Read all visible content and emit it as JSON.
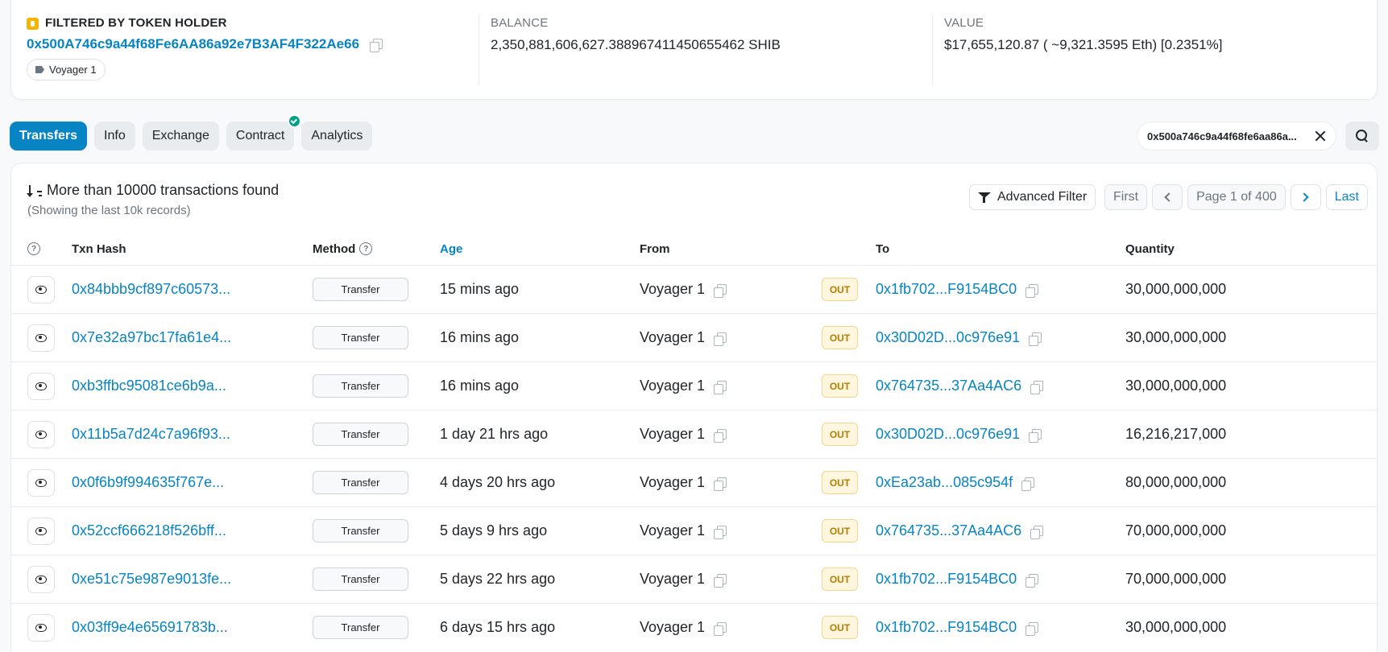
{
  "summary": {
    "holder_label": "FILTERED BY TOKEN HOLDER",
    "holder_address": "0x500A746c9a44f68Fe6AA86a92e7B3AF4F322Ae66",
    "holder_tag": "Voyager 1",
    "balance_label": "BALANCE",
    "balance_value": "2,350,881,606,627.388967411450655462 SHIB",
    "value_label": "VALUE",
    "value_value": "$17,655,120.87 ( ~9,321.3595 Eth) [0.2351%]"
  },
  "tabs": [
    {
      "label": "Transfers",
      "active": true
    },
    {
      "label": "Info"
    },
    {
      "label": "Exchange"
    },
    {
      "label": "Contract",
      "verified": true
    },
    {
      "label": "Analytics"
    }
  ],
  "filter_chip": "0x500a746c9a44f68fe6aa86a...",
  "results": {
    "count_text": "More than 10000 transactions found",
    "sub_text": "(Showing the last 10k records)",
    "advanced_filter": "Advanced Filter",
    "pager": {
      "first": "First",
      "page": "Page 1 of 400",
      "last": "Last"
    }
  },
  "table": {
    "headers": {
      "hash": "Txn Hash",
      "method": "Method",
      "age": "Age",
      "from": "From",
      "to": "To",
      "quantity": "Quantity"
    },
    "rows": [
      {
        "hash": "0x84bbb9cf897c60573...",
        "method": "Transfer",
        "age": "15 mins ago",
        "from": "Voyager 1",
        "dir": "OUT",
        "to": "0x1fb702...F9154BC0",
        "qty": "30,000,000,000"
      },
      {
        "hash": "0x7e32a97bc17fa61e4...",
        "method": "Transfer",
        "age": "16 mins ago",
        "from": "Voyager 1",
        "dir": "OUT",
        "to": "0x30D02D...0c976e91",
        "qty": "30,000,000,000"
      },
      {
        "hash": "0xb3ffbc95081ce6b9a...",
        "method": "Transfer",
        "age": "16 mins ago",
        "from": "Voyager 1",
        "dir": "OUT",
        "to": "0x764735...37Aa4AC6",
        "qty": "30,000,000,000"
      },
      {
        "hash": "0x11b5a7d24c7a96f93...",
        "method": "Transfer",
        "age": "1 day 21 hrs ago",
        "from": "Voyager 1",
        "dir": "OUT",
        "to": "0x30D02D...0c976e91",
        "qty": "16,216,217,000"
      },
      {
        "hash": "0x0f6b9f994635f767e...",
        "method": "Transfer",
        "age": "4 days 20 hrs ago",
        "from": "Voyager 1",
        "dir": "OUT",
        "to": "0xEa23ab...085c954f",
        "qty": "80,000,000,000"
      },
      {
        "hash": "0x52ccf666218f526bff...",
        "method": "Transfer",
        "age": "5 days 9 hrs ago",
        "from": "Voyager 1",
        "dir": "OUT",
        "to": "0x764735...37Aa4AC6",
        "qty": "70,000,000,000"
      },
      {
        "hash": "0xe51c75e987e9013fe...",
        "method": "Transfer",
        "age": "5 days 22 hrs ago",
        "from": "Voyager 1",
        "dir": "OUT",
        "to": "0x1fb702...F9154BC0",
        "qty": "70,000,000,000"
      },
      {
        "hash": "0x03ff9e4e65691783b...",
        "method": "Transfer",
        "age": "6 days 15 hrs ago",
        "from": "Voyager 1",
        "dir": "OUT",
        "to": "0x1fb702...F9154BC0",
        "qty": "30,000,000,000"
      }
    ]
  }
}
